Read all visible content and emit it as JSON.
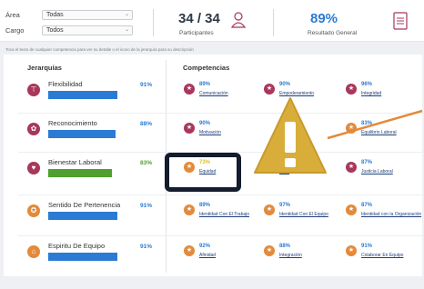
{
  "filters": {
    "area_label": "Área",
    "area_value": "Todas",
    "cargo_label": "Cargo",
    "cargo_value": "Todos"
  },
  "stats": {
    "participants_value": "34 / 34",
    "participants_label": "Participantes",
    "overall_value": "89%",
    "overall_label": "Resultado General"
  },
  "hint": "Toca el texto de cualquier competencia para ver su detalle o el icono de la jerarquía para su descripción",
  "headers": {
    "jerarquias": "Jerarquías",
    "competencias": "Competencias"
  },
  "colors": {
    "blue": "#2b7bd4",
    "green": "#4fa02e",
    "yellow": "#e0c020",
    "maroon": "#a8375a",
    "orange": "#e38a3b"
  },
  "jerarquias": [
    {
      "label": "Flexibilidad",
      "pct": "91%",
      "value": 0.91,
      "color": "green-no",
      "icon": "flexibility-icon"
    },
    {
      "label": "Reconocimiento",
      "pct": "88%",
      "value": 0.88,
      "icon": "star-icon"
    },
    {
      "label": "Bienestar Laboral",
      "pct": "83%",
      "value": 0.83,
      "icon": "heart-icon"
    },
    {
      "label": "Sentido De Pertenencia",
      "pct": "91%",
      "value": 0.91,
      "icon": "pertenencia-icon"
    },
    {
      "label": "Espiritu De Equipo",
      "pct": "91%",
      "value": 0.91,
      "icon": "team-icon"
    }
  ],
  "competencias": [
    [
      {
        "pct": "89%",
        "name": "Comunicación"
      },
      {
        "pct": "90%",
        "name": "Empoderamiento"
      },
      {
        "pct": "96%",
        "name": "Integridad"
      }
    ],
    [
      {
        "pct": "90%",
        "name": "Motivación"
      },
      {
        "pct": "",
        "name": ""
      },
      {
        "pct": "83%",
        "name": "Equilibrio Laboral"
      }
    ],
    [
      {
        "pct": "73%",
        "name": "Equidad"
      },
      {
        "pct": "",
        "name": "...mo"
      },
      {
        "pct": "87%",
        "name": "Justicia Laboral"
      }
    ],
    [
      {
        "pct": "89%",
        "name": "Identidad Con El Trabajo"
      },
      {
        "pct": "97%",
        "name": "Identidad Con El Equipo"
      },
      {
        "pct": "87%",
        "name": "Identidad con la Organización"
      }
    ],
    [
      {
        "pct": "92%",
        "name": "Afinidad"
      },
      {
        "pct": "88%",
        "name": "Integración"
      },
      {
        "pct": "91%",
        "name": "Colaborar En Equipo"
      }
    ]
  ]
}
